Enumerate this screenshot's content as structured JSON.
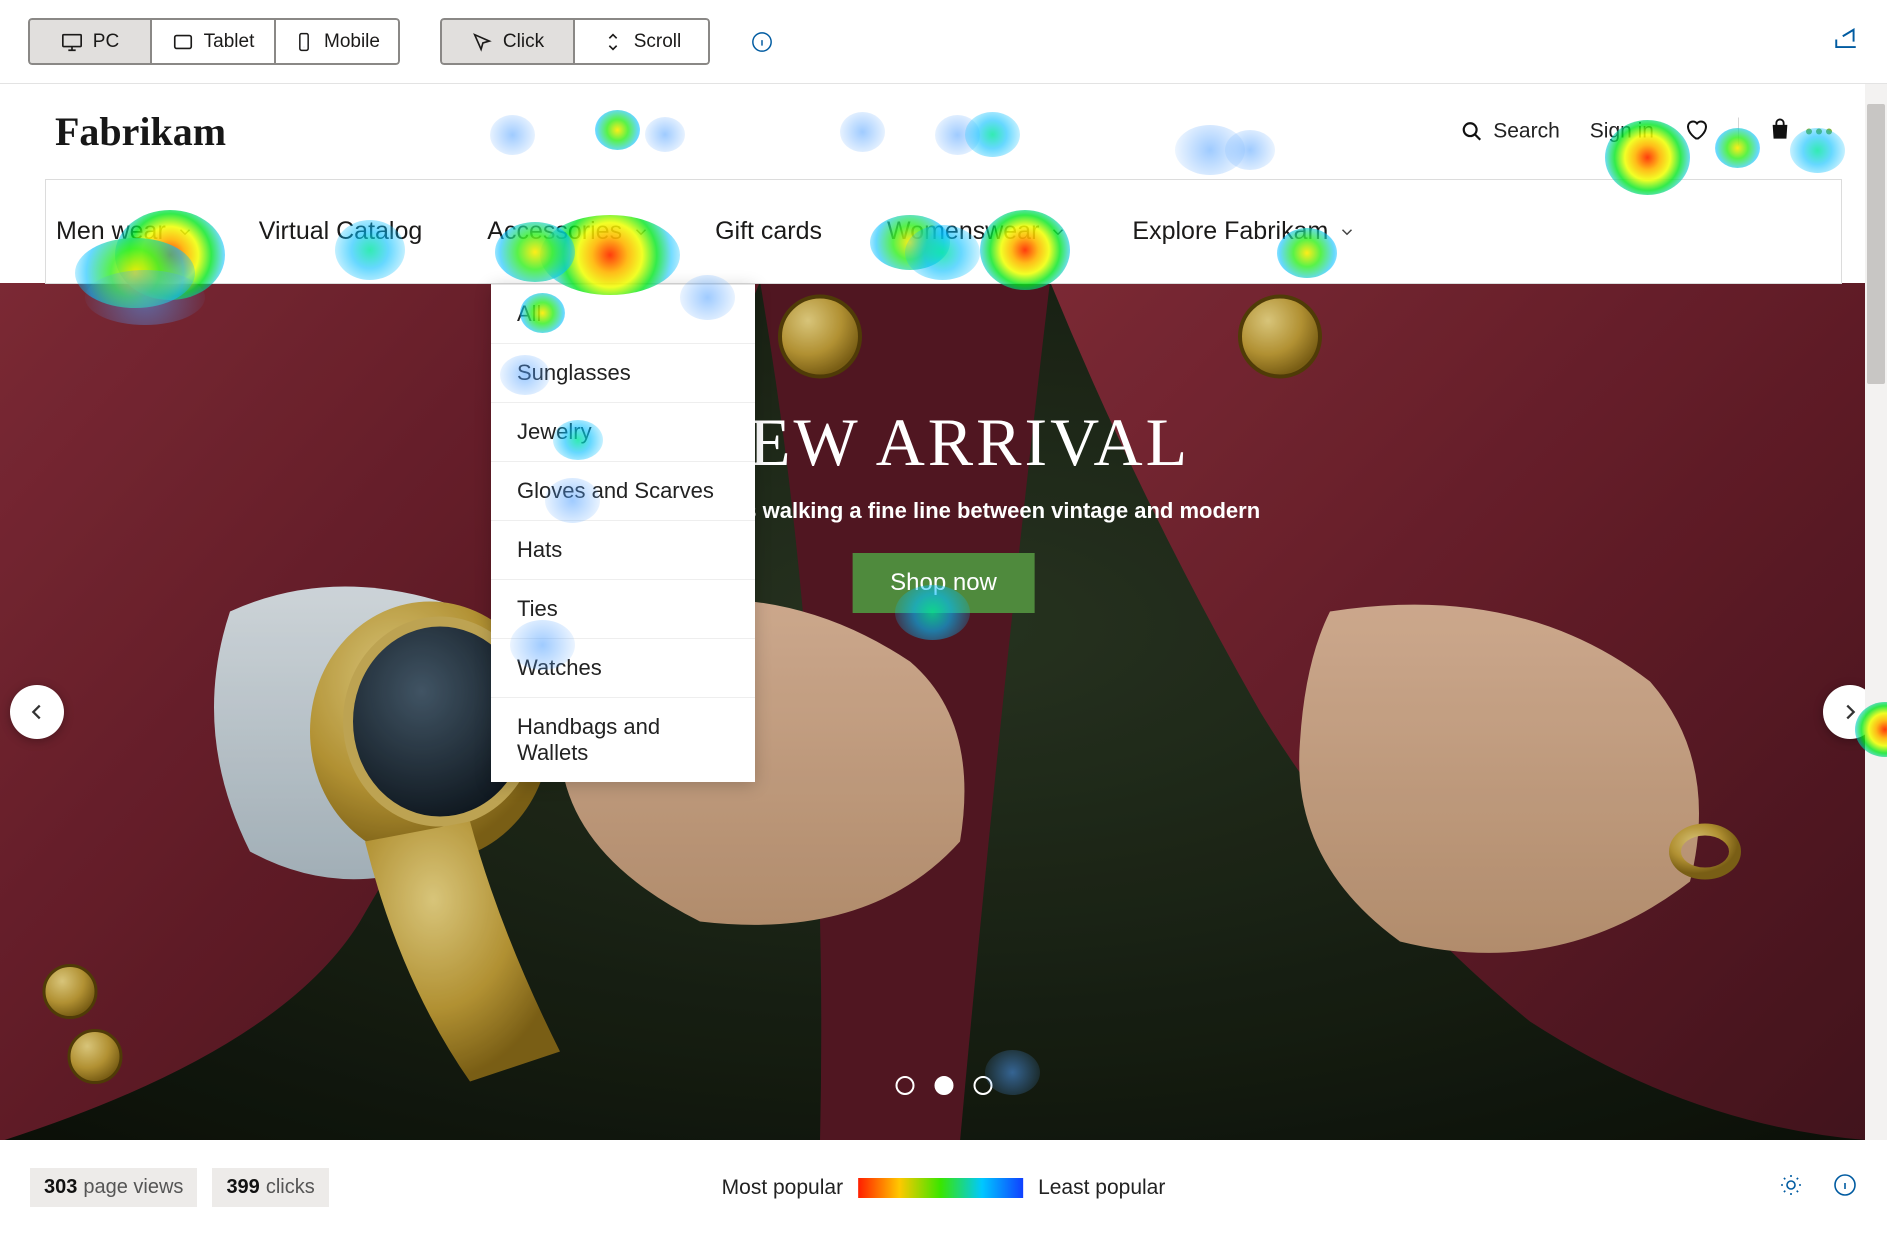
{
  "toolbar": {
    "devices": [
      "PC",
      "Tablet",
      "Mobile"
    ],
    "deviceActive": 0,
    "modes": [
      "Click",
      "Scroll"
    ],
    "modeActive": 0
  },
  "brand": "Fabrikam",
  "actions": {
    "search": "Search",
    "signin": "Sign in"
  },
  "nav": [
    "Men wear",
    "Virtual Catalog",
    "Accessories",
    "Gift cards",
    "Womenswear",
    "Explore Fabrikam"
  ],
  "hasChevron": [
    true,
    false,
    true,
    false,
    true,
    true
  ],
  "dropdown": [
    "All",
    "Sunglasses",
    "Jewelry",
    "Gloves and Scarves",
    "Hats",
    "Ties",
    "Watches",
    "Handbags and Wallets"
  ],
  "hero": {
    "title": "NEW ARRIVAL",
    "sub": "Accessories walking a fine line between vintage and modern",
    "cta": "Shop now",
    "activeDot": 1,
    "dots": 3
  },
  "stats": {
    "views": "303",
    "views_label": "page views",
    "clicks": "399",
    "clicks_label": "clicks",
    "legend_most": "Most popular",
    "legend_least": "Least popular"
  },
  "more_dots_color": "#7cb342"
}
